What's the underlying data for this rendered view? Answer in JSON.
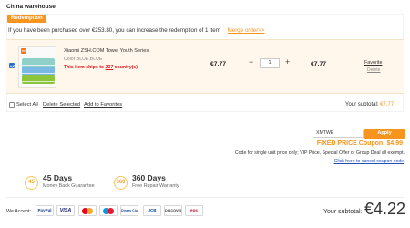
{
  "warehouse": {
    "title": "China warehouse"
  },
  "redemption": {
    "badge": "Redemption",
    "note": "If you have been purchased over €253.80, you can increase the redemption of 1 item",
    "merge_link": "Merge order>>"
  },
  "cart_item": {
    "checked": true,
    "name": "Xiaomi ZSH.COM Towel Youth Series",
    "color": "Color:BLUE,BLUE",
    "ship_prefix": "This item ships to ",
    "ship_count": "237",
    "ship_suffix": " country(s)",
    "unit_price": "€7.77",
    "quantity": "1",
    "minus_label": "−",
    "plus_label": "+",
    "line_total": "€7.77",
    "favorite_label": "Favorite",
    "delete_label": "Delete",
    "mi_logo": "mi"
  },
  "cart_actions": {
    "select_all": "Select All",
    "delete_selected": "Delete Selected",
    "add_to_favorites": "Add to Favorites",
    "subtotal_label": "Your subtotal:",
    "subtotal_value": "€7.77"
  },
  "coupon": {
    "code": "XMTWE",
    "apply_label": "Apply",
    "discount": "FIXED PRICE Coupon: $4.99",
    "note": "Code for single unit price only; VIP Price, Special Offer or Group Deal all exempt.",
    "cancel_link": "Click here to cancel coupon code"
  },
  "guarantees": [
    {
      "icon_text": "45",
      "title": "45 Days",
      "subtitle": "Money Back Guarantee"
    },
    {
      "icon_text": "360",
      "title": "360 Days",
      "subtitle": "Free Repair Warranty"
    }
  ],
  "footer": {
    "we_accept": "We Accept:",
    "payments": [
      "PayPal",
      "VISA",
      "MasterCard",
      "Maestro",
      "Diners Club",
      "JCB",
      "DISCOVER",
      "eps"
    ],
    "subtotal_label": "Your subtotal:",
    "subtotal_value": "€4.22"
  },
  "colors": {
    "accent": "#f7941d",
    "danger": "#e0161a",
    "link": "#1f4fb5",
    "checkbox": "#2b6ed3"
  }
}
